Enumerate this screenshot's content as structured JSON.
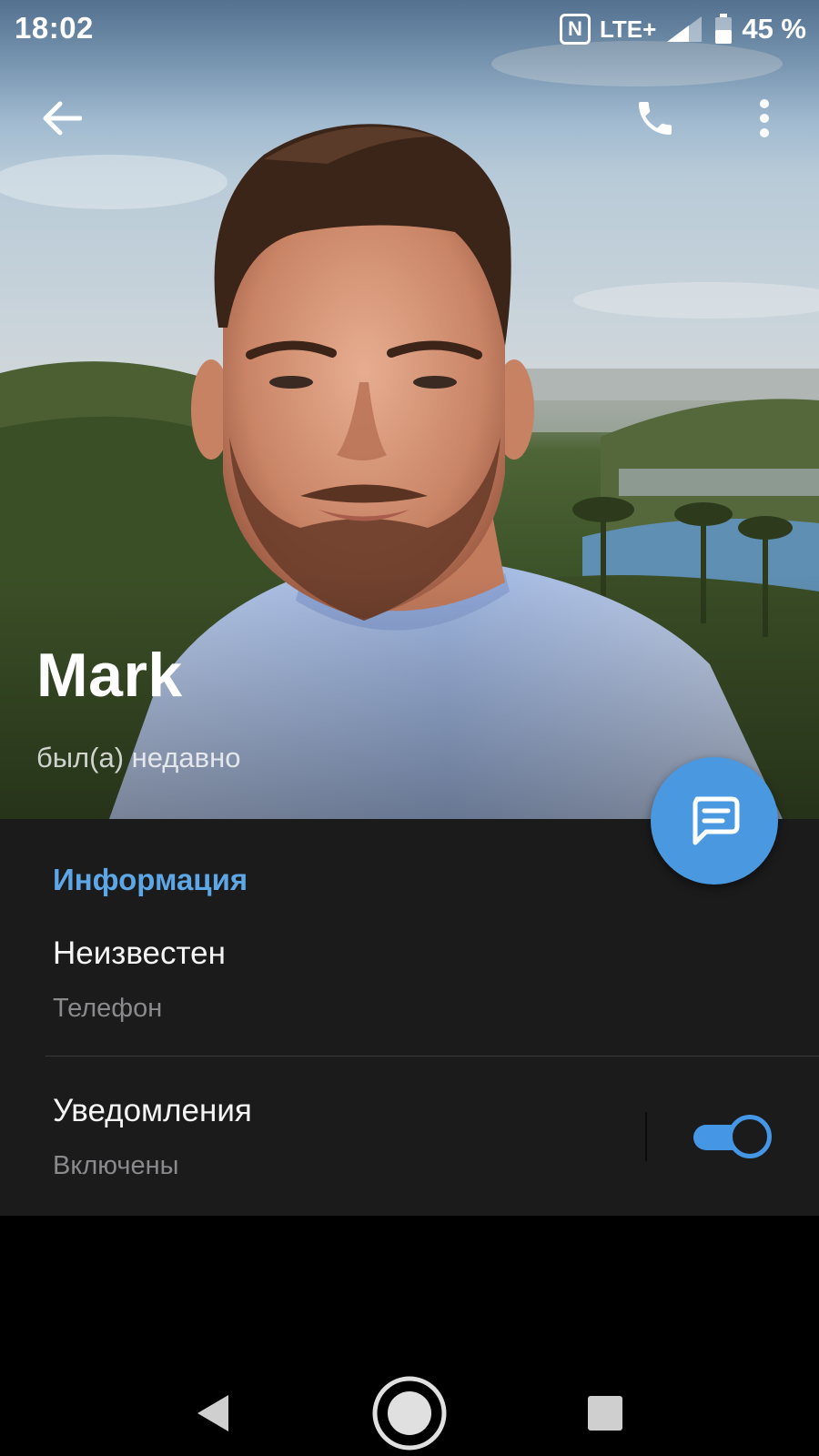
{
  "status_bar": {
    "time": "18:02",
    "nfc_label": "N",
    "network": "LTE+",
    "battery": "45 %"
  },
  "toolbar": {
    "back_icon": "arrow-left-icon",
    "call_icon": "phone-icon",
    "more_icon": "more-vertical-icon"
  },
  "profile": {
    "name": "Mark",
    "status": "был(а) недавно"
  },
  "info": {
    "section_title": "Информация",
    "phone_value": "Неизвестен",
    "phone_label": "Телефон",
    "notifications_title": "Уведомления",
    "notifications_value": "Включены",
    "notifications_enabled": true
  },
  "fab": {
    "icon": "message-icon"
  },
  "nav_bar": {
    "back_icon": "triangle-back-icon",
    "home_icon": "circle-home-icon",
    "recents_icon": "square-recents-icon"
  },
  "colors": {
    "accent": "#5ea7e6",
    "fab": "#4a98e0",
    "panel": "#1b1b1c",
    "background": "#000000"
  }
}
